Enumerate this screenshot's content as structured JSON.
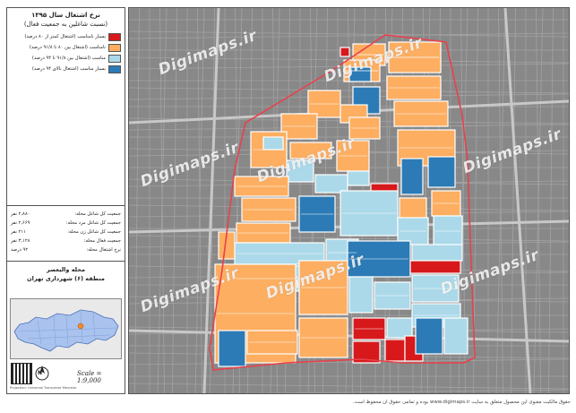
{
  "panel": {
    "title_line1": "نرخ اشتغال سال ۱۳۹۵",
    "title_line2": "(نسبت شاغلین به جمعیت فعال)",
    "legend": [
      {
        "label": "بسیار نامناسب (اشتغال کمتر از ۸۰ درصد)",
        "color": "#d7191c"
      },
      {
        "label": "نامناسب (اشتغال بین ۸۰ تا ۹۱/۸ درصد)",
        "color": "#fdae61"
      },
      {
        "label": "مناسب (اشتغال بین ۹۱/۸ تا ۹۴ درصد)",
        "color": "#abd9e9"
      },
      {
        "label": "بسیار مناسب (اشتغال بالای ۹۴ درصد)",
        "color": "#2c7bb6"
      }
    ],
    "stats": [
      {
        "label": "جمعیت کل شاغل محله:",
        "value": "۲,۸۸۰ نفر"
      },
      {
        "label": "جمعیت کل شاغل مرد محله:",
        "value": "۲,۶۶۹ نفر"
      },
      {
        "label": "جمعیت کل شاغل زن محله:",
        "value": "۲۱۱ نفر"
      },
      {
        "label": "جمعیت فعال محله:",
        "value": "۳,۱۲۸ نفر"
      },
      {
        "label": "نرخ اشتغال محله:",
        "value": "۹۲ درصد"
      }
    ],
    "area_line1": "محله والیعصر",
    "area_line2": "منطقه (۶) شهرداری تهران",
    "north_label": "N",
    "scale_label": "Scale = 1:9,000",
    "credit": "Projection: Universal Transverse Mercator"
  },
  "map": {
    "watermark": "Digimaps.ir",
    "boundary_color": "#e8414b"
  },
  "footer": "حقوق مالکیت معنوی این محصول متعلق به سایت www.digimaps.ir بوده و تمامی حقوق آن محفوظ است."
}
